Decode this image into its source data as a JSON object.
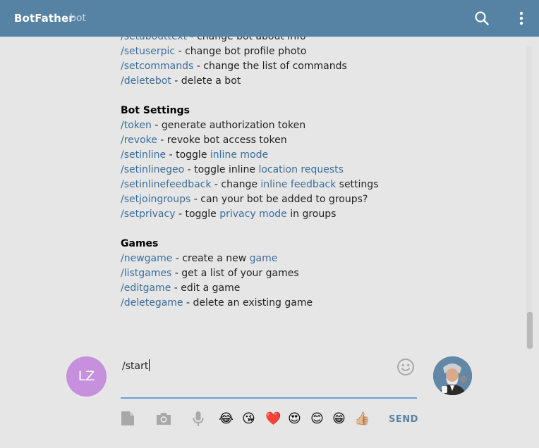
{
  "header": {
    "title": "BotFather",
    "subtitle": "bot",
    "icons": [
      "search-icon",
      "more-vertical-icon"
    ]
  },
  "messages": {
    "top_section": [
      {
        "cmd": "/setabouttext",
        "desc": " - change bot about info"
      },
      {
        "cmd": "/setuserpic",
        "desc": " - change bot profile photo"
      },
      {
        "cmd": "/setcommands",
        "desc": " - change the list of commands"
      },
      {
        "cmd": "/deletebot",
        "desc": " - delete a bot"
      }
    ],
    "bot_settings_title": "Bot Settings",
    "bot_settings": {
      "token": {
        "cmd": "/token",
        "desc": " - generate authorization token"
      },
      "revoke": {
        "cmd": "/revoke",
        "desc": " - revoke bot access token"
      },
      "setinline": {
        "cmd": "/setinline",
        "pre": " - toggle ",
        "link": "inline mode",
        "post": ""
      },
      "setinlinegeo": {
        "cmd": "/setinlinegeo",
        "pre": " - toggle inline ",
        "link": "location requests",
        "post": ""
      },
      "setinlinefeedback": {
        "cmd": "/setinlinefeedback",
        "pre": " - change ",
        "link": "inline feedback",
        "post": " settings"
      },
      "setjoingroups": {
        "cmd": "/setjoingroups",
        "desc": " - can your bot be added to groups?"
      },
      "setprivacy": {
        "cmd": "/setprivacy",
        "pre": " - toggle ",
        "link": "privacy mode",
        "post": " in groups"
      }
    },
    "games_title": "Games",
    "games": {
      "newgame": {
        "cmd": "/newgame",
        "pre": " - create a new ",
        "link": "game",
        "post": ""
      },
      "listgames": {
        "cmd": "/listgames",
        "desc": " - get a list of your games"
      },
      "editgame": {
        "cmd": "/editgame",
        "desc": " - edit a game"
      },
      "deletegame": {
        "cmd": "/deletegame",
        "desc": " - delete an existing game"
      }
    }
  },
  "composer": {
    "user_initials": "LZ",
    "input_value": "/start",
    "send_label": "SEND",
    "emojis": [
      "😂",
      "😘",
      "❤️",
      "😍",
      "😊",
      "😁",
      "👍🏼"
    ],
    "tools": [
      "file-icon",
      "camera-icon",
      "microphone-icon"
    ]
  },
  "colors": {
    "header": "#5682a3",
    "link": "#3a6d99",
    "avatar": "#c690dc",
    "input_underline": "#6ea2d4"
  }
}
